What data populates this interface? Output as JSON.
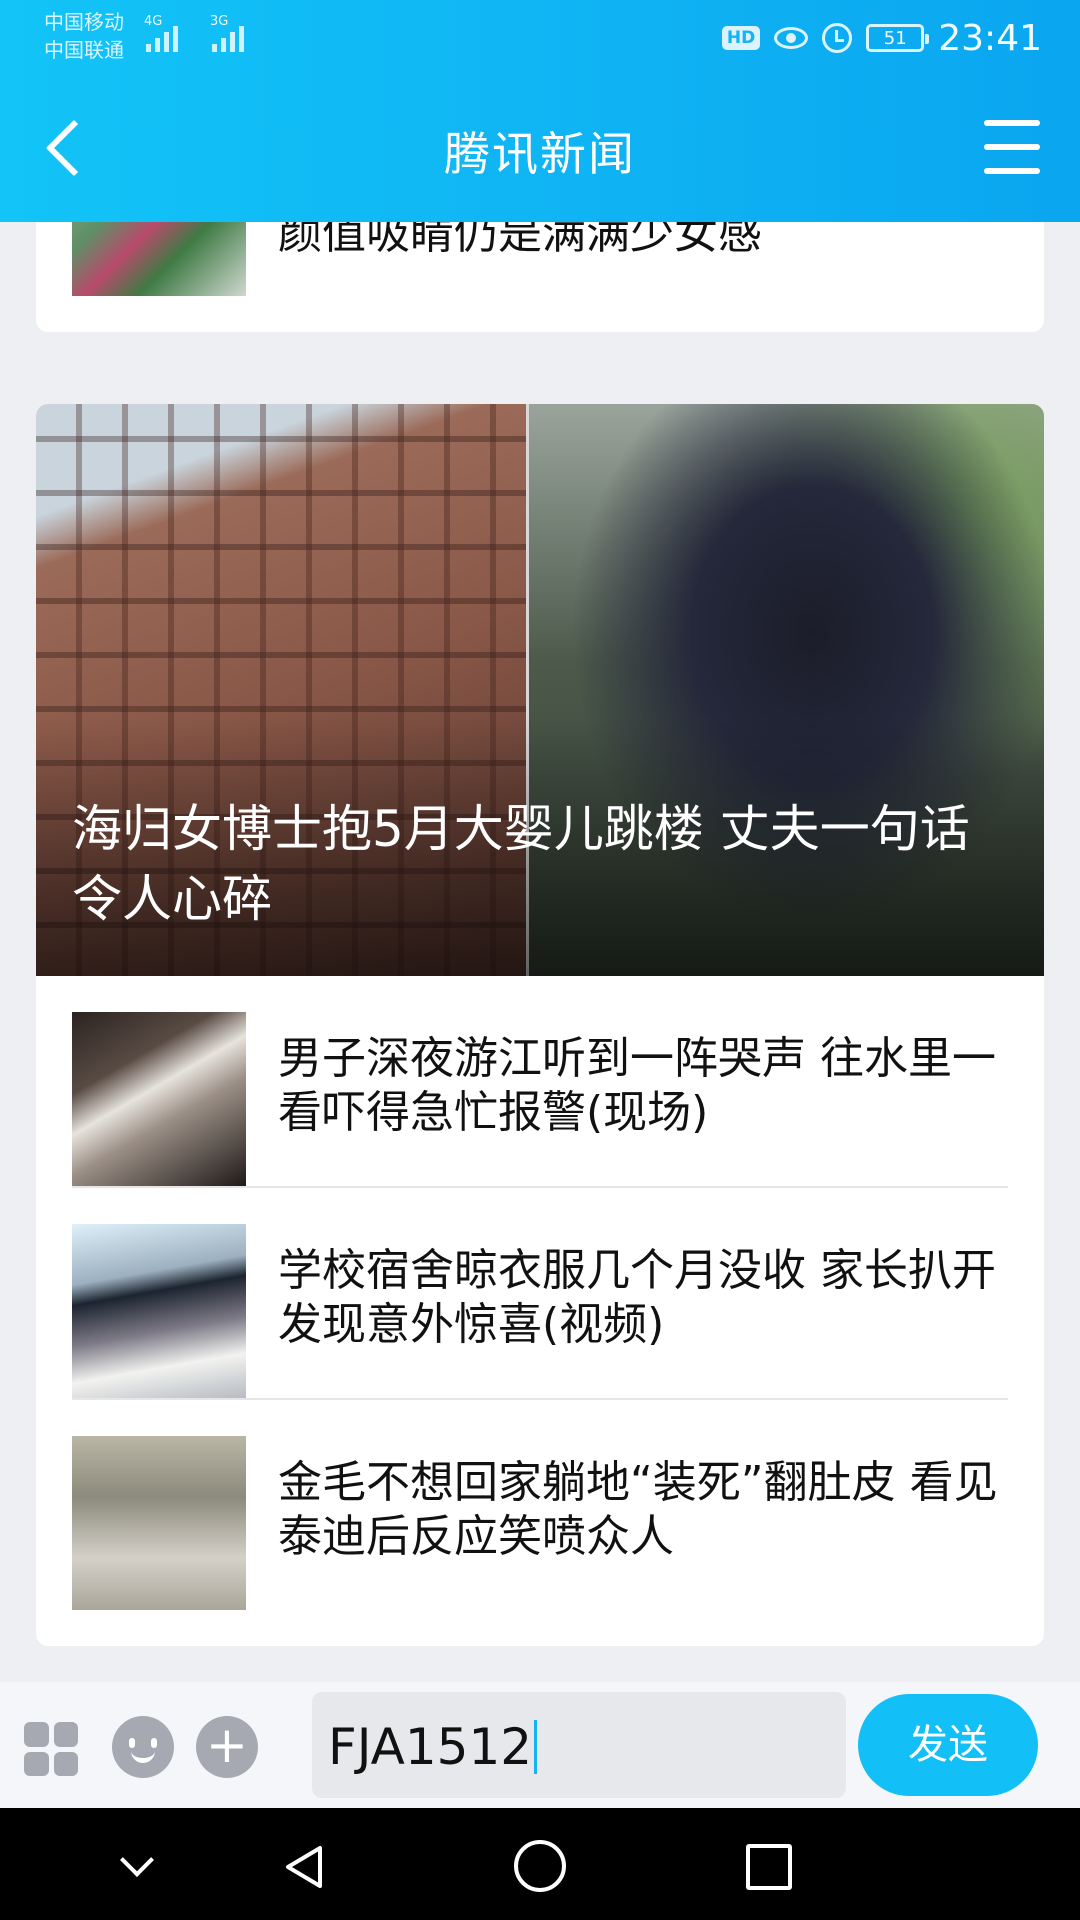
{
  "status_bar": {
    "carrier_1": "中国移动",
    "carrier_2": "中国联通",
    "net_1": "4G",
    "net_2": "3G",
    "hd": "HD",
    "battery": "51",
    "time": "23:41"
  },
  "header": {
    "title": "腾讯新闻",
    "back_icon": "chevron-left-icon",
    "menu_icon": "hamburger-menu-icon"
  },
  "articles": {
    "partial_title": "颜值吸睛仍是满满少女感",
    "hero_title": "海归女博士抱5月大婴儿跳楼 丈夫一句话令人心碎",
    "items": [
      {
        "title": "男子深夜游江听到一阵哭声 往水里一看吓得急忙报警(现场)"
      },
      {
        "title": "学校宿舍晾衣服几个月没收 家长扒开发现意外惊喜(视频)"
      },
      {
        "title": "金毛不想回家躺地“装死”翻肚皮 看见泰迪后反应笑喷众人"
      }
    ]
  },
  "input_bar": {
    "value": "FJA1512",
    "send_label": "发送",
    "plus_label": "+",
    "icons": [
      "apps-grid-icon",
      "emoji-icon",
      "plus-icon"
    ]
  },
  "system_nav": {
    "icons": [
      "chevron-down-icon",
      "back-triangle-icon",
      "home-circle-icon",
      "recents-square-icon"
    ]
  },
  "colors": {
    "accent": "#12bff7",
    "header_gradient_start": "#12c4f7",
    "header_gradient_end": "#0aa6f0"
  }
}
